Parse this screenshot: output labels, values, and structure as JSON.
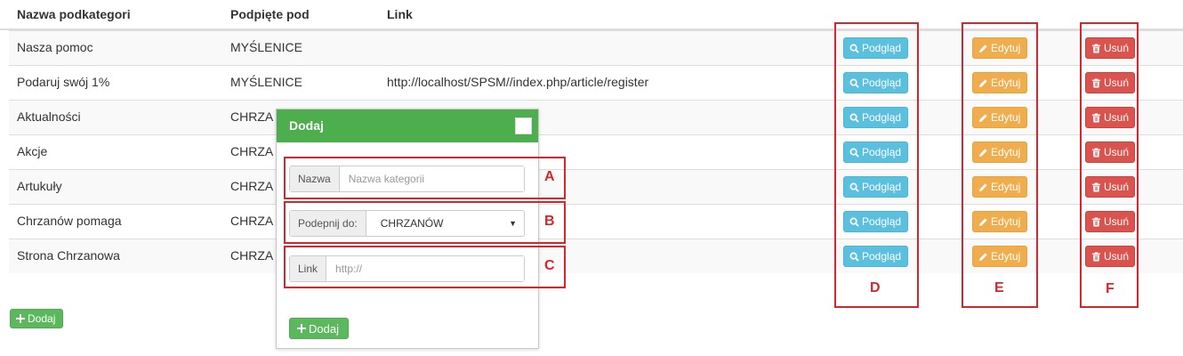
{
  "table": {
    "headers": [
      "Nazwa podkategori",
      "Podpięte pod",
      "Link"
    ],
    "rows": [
      {
        "name": "Nasza pomoc",
        "parent": "MYŚLENICE",
        "link": ""
      },
      {
        "name": "Podaruj swój 1%",
        "parent": "MYŚLENICE",
        "link": "http://localhost/SPSM//index.php/article/register"
      },
      {
        "name": "Aktualności",
        "parent": "CHRZA",
        "link": ""
      },
      {
        "name": "Akcje",
        "parent": "CHRZA",
        "link": ""
      },
      {
        "name": "Artukuły",
        "parent": "CHRZA",
        "link": ""
      },
      {
        "name": "Chrzanów pomaga",
        "parent": "CHRZA",
        "link": ""
      },
      {
        "name": "Strona Chrzanowa",
        "parent": "CHRZA",
        "link": ""
      }
    ],
    "actions": {
      "preview": "Podgląd",
      "edit": "Edytuj",
      "delete": "Usuń"
    }
  },
  "add_button_label": "Dodaj",
  "modal": {
    "title": "Dodaj",
    "name_addon": "Nazwa",
    "name_placeholder": "Nazwa kategorii",
    "attach_addon": "Podepnij do:",
    "attach_selected": "CHRZANÓW",
    "link_addon": "Link",
    "link_placeholder": "http://",
    "submit_label": "Dodaj"
  },
  "annotations": [
    "A",
    "B",
    "C",
    "D",
    "E",
    "F"
  ],
  "colors": {
    "info": "#5bc0de",
    "warning": "#f0ad4e",
    "danger": "#d9534f",
    "success": "#5cb85c",
    "annotation": "#d7262b"
  },
  "icons": {
    "preview": "search-icon",
    "edit": "pencil-icon",
    "delete": "trash-icon",
    "add": "plus-icon"
  }
}
